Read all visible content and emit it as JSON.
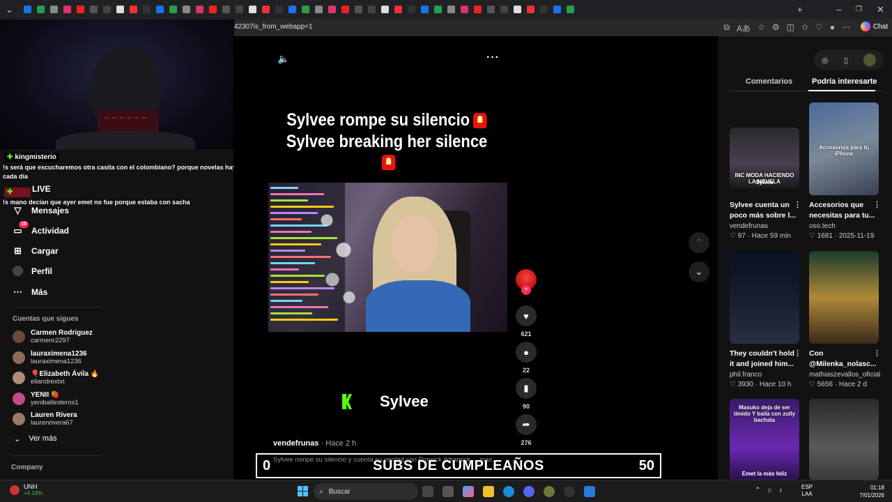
{
  "browser": {
    "url_fragment": "42307is_from_webapp=1",
    "chat_label": "Chat"
  },
  "stream_overlay": {
    "chat_messages": [
      {
        "user": "kingmisterio",
        "text": ""
      },
      {
        "user": "",
        "text": "!s será que escucharemos otra casita con el colombiano? porque novelas hay cada día"
      },
      {
        "user": "",
        "text": "!s mano decían que ayer emet no fue porque estaba con sacha"
      }
    ],
    "subs_goal": {
      "current": "0",
      "title": "SUBS DE CUMPLEAÑOS",
      "target": "50",
      "progress": 0.0
    }
  },
  "sidebar": {
    "nav": [
      {
        "label": "LIVE",
        "icon": "live-icon"
      },
      {
        "label": "Mensajes",
        "icon": "message-icon"
      },
      {
        "label": "Actividad",
        "icon": "activity-icon",
        "badge": "10"
      },
      {
        "label": "Cargar",
        "icon": "upload-icon"
      },
      {
        "label": "Perfil",
        "icon": "profile-icon"
      },
      {
        "label": "Más",
        "icon": "more-icon"
      }
    ],
    "following_title": "Cuentas que sigues",
    "following": [
      {
        "name": "Carmen Rodriguez",
        "handle": "carmenr2297",
        "color": "#6a4a3a"
      },
      {
        "name": "lauraximena1236",
        "handle": "lauraximena1236",
        "color": "#8a6a5a"
      },
      {
        "name": "🎈Elizabeth Ávila 🔥",
        "handle": "eliandrextxt",
        "color": "#b08a7a"
      },
      {
        "name": "YENII 🍓",
        "handle": "yeniballesteros1",
        "color": "#c04a8a"
      },
      {
        "name": "Lauren Rivera",
        "handle": "laurenrivera67",
        "color": "#9a7a6a"
      }
    ],
    "see_more": "Ver más",
    "company": "Company"
  },
  "video": {
    "headline_1": "Sylvee rompe su silencio",
    "headline_2": "Sylvee breaking her silence",
    "creator_tag": "Sylvee",
    "author": "vendefrunas",
    "time": "· Hace 2 h",
    "caption": "Sylvee rompe su silencio y cuenta su verdad con Ponsick #dramick ... más",
    "stats": {
      "likes": "621",
      "comments": "22",
      "saves": "90",
      "shares": "276"
    }
  },
  "right_panel": {
    "tabs": [
      "Comentarios",
      "Podría interesarte"
    ],
    "active_tab": "Podría interesarte",
    "cards": [
      {
        "title": "Sylvee cuenta un poco más sobre l...",
        "author": "vendefrunas",
        "likes": "97",
        "time": "Hace 59 min",
        "overlay": "INC MODA HACIENDO LA NOVELA",
        "overlay_sub": "Sylvee"
      },
      {
        "title": "Accesorios que necesitas para tu...",
        "author": "oso.tech",
        "likes": "1681",
        "time": "2025-11-19",
        "overlay": "Accesorios para tu iPhone",
        "overlay_sub": ""
      },
      {
        "title": "They couldn't hold it and joined him...",
        "author": "phil.franco",
        "likes": "3930",
        "time": "Hace 10 h",
        "overlay": "",
        "overlay_sub": ""
      },
      {
        "title": "Con @Milenka_nolasc...",
        "author": "mathiaszevallos_oficial",
        "likes": "5656",
        "time": "Hace 2 d",
        "overlay": "",
        "overlay_sub": ""
      },
      {
        "title": "",
        "author": "",
        "likes": "",
        "time": "",
        "overlay": "Masuko deja de ser tímido Y baila con zully bachata",
        "overlay_sub": "Emet la más feliz"
      },
      {
        "title": "",
        "author": "",
        "likes": "",
        "time": "",
        "overlay": "",
        "overlay_sub": ""
      }
    ]
  },
  "taskbar": {
    "weather_label": "UNH",
    "weather_change": "+4.18%",
    "search_placeholder": "Buscar",
    "lang_1": "ESP",
    "lang_2": "LAA",
    "time": "01:18",
    "date": "7/01/2026"
  }
}
